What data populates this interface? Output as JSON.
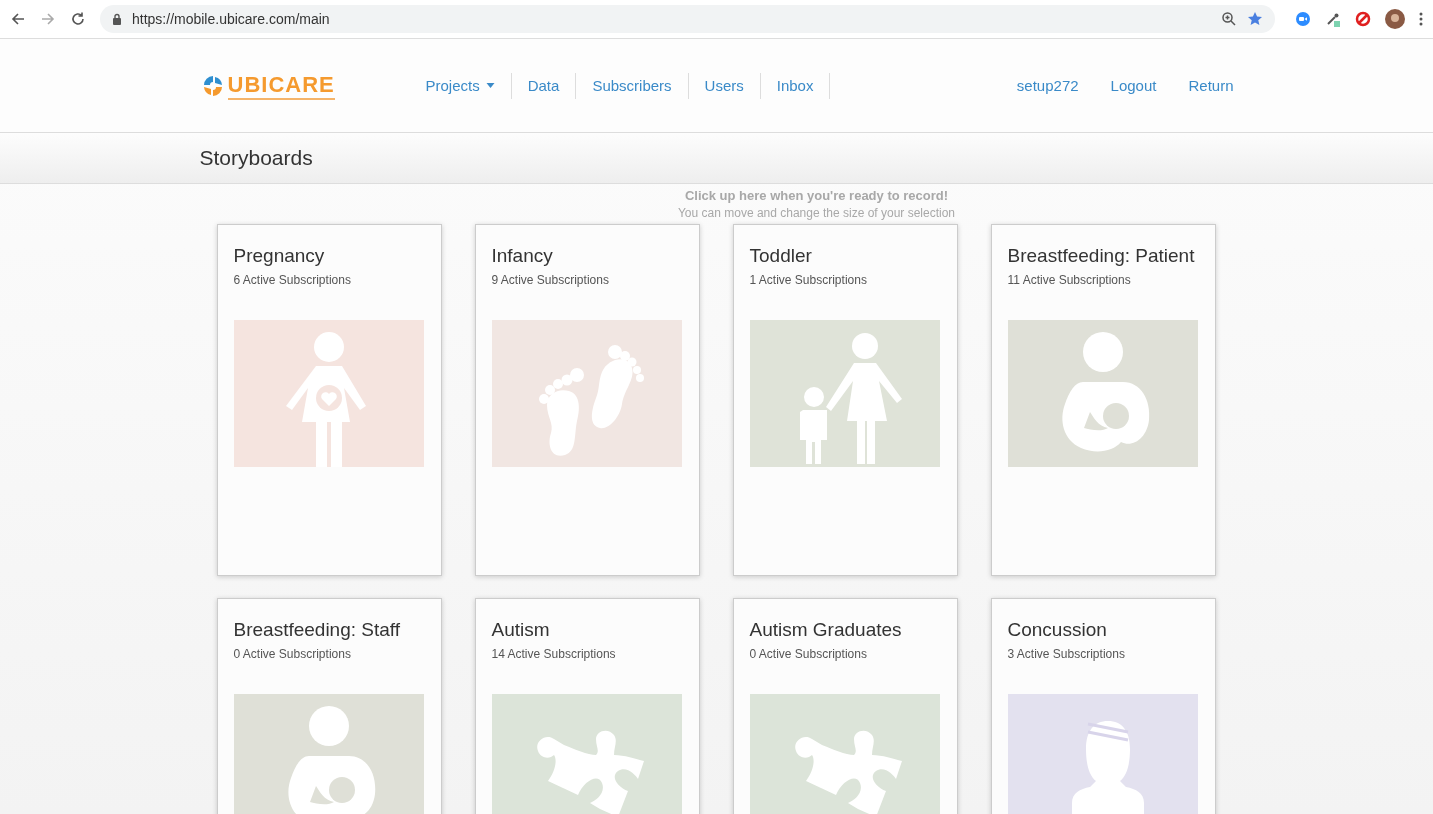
{
  "browser": {
    "url": "https://mobile.ubicare.com/main"
  },
  "header": {
    "logo": "UBICARE",
    "nav": [
      {
        "label": "Projects",
        "dropdown": true
      },
      {
        "label": "Data",
        "dropdown": false
      },
      {
        "label": "Subscribers",
        "dropdown": false
      },
      {
        "label": "Users",
        "dropdown": false
      },
      {
        "label": "Inbox",
        "dropdown": false
      }
    ],
    "account": [
      "setup272",
      "Logout",
      "Return"
    ]
  },
  "page_title": "Storyboards",
  "recorder_hint": {
    "title": "Click up here when you're ready to record!",
    "subtitle": "You can move and change the size of your selection"
  },
  "storyboards": [
    {
      "title": "Pregnancy",
      "subscriptions": "6 Active Subscriptions",
      "kind": "pregnancy",
      "color": "#f5e4df"
    },
    {
      "title": "Infancy",
      "subscriptions": "9 Active Subscriptions",
      "kind": "feet",
      "color": "#f1e6e2"
    },
    {
      "title": "Toddler",
      "subscriptions": "1 Active Subscriptions",
      "kind": "parent-child",
      "color": "#dfe3d8"
    },
    {
      "title": "Breastfeeding: Patient",
      "subscriptions": "11 Active Subscriptions",
      "kind": "nursing",
      "color": "#dfe0d7"
    },
    {
      "title": "Breastfeeding: Staff",
      "subscriptions": "0 Active Subscriptions",
      "kind": "nursing",
      "color": "#dfe0d7"
    },
    {
      "title": "Autism",
      "subscriptions": "14 Active Subscriptions",
      "kind": "puzzle",
      "color": "#dce4d9"
    },
    {
      "title": "Autism Graduates",
      "subscriptions": "0 Active Subscriptions",
      "kind": "puzzle",
      "color": "#dce4d9"
    },
    {
      "title": "Concussion",
      "subscriptions": "3 Active Subscriptions",
      "kind": "bandaged-head",
      "color": "#e3e1ef"
    }
  ]
}
